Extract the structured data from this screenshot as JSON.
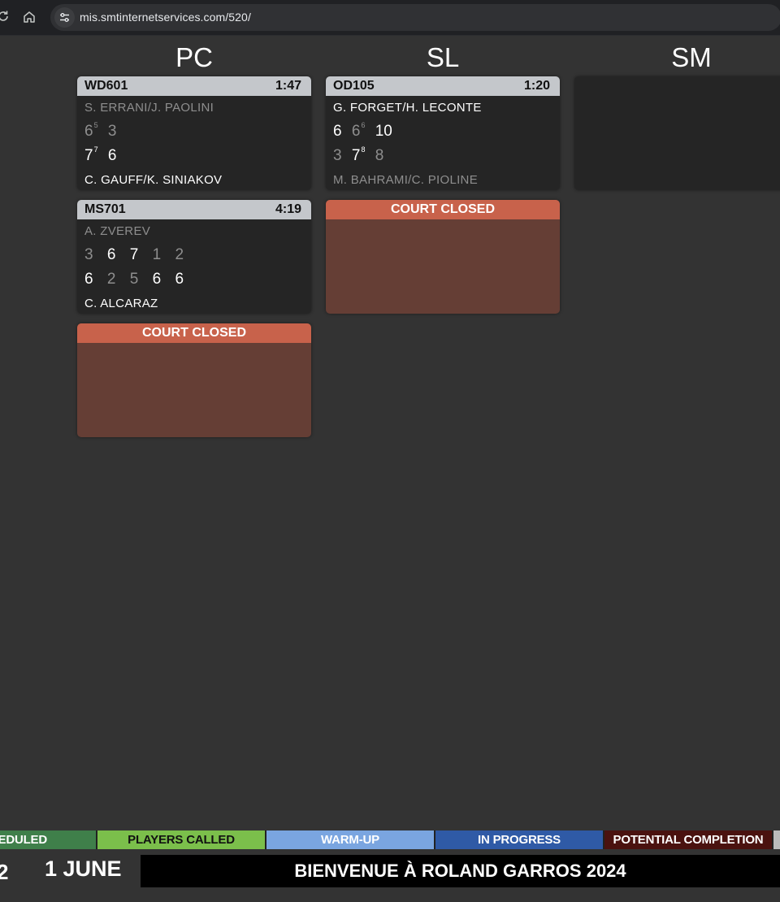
{
  "browser": {
    "url": "mis.smtinternetservices.com/520/"
  },
  "courts": [
    {
      "code": "PC"
    },
    {
      "code": "SL"
    },
    {
      "code": "SM"
    }
  ],
  "matches": [
    {
      "id": "WD601",
      "duration": "1:47",
      "team_top": "S. ERRANI/J. PAOLINI",
      "team_bottom": "C. GAUFF/K. SINIAKOV",
      "top_scores": [
        "6",
        "3"
      ],
      "top_tiebreaks": [
        "5",
        ""
      ],
      "bottom_scores": [
        "7",
        "6"
      ],
      "bottom_tiebreaks": [
        "7",
        ""
      ]
    },
    {
      "id": "OD105",
      "duration": "1:20",
      "team_top": "G. FORGET/H. LECONTE",
      "team_bottom": "M. BAHRAMI/C. PIOLINE",
      "top_scores": [
        "6",
        "6",
        "10"
      ],
      "top_tiebreaks": [
        "",
        "6",
        ""
      ],
      "bottom_scores": [
        "3",
        "7",
        "8"
      ],
      "bottom_tiebreaks": [
        "",
        "8",
        ""
      ]
    },
    {
      "id": "MS701",
      "duration": "4:19",
      "team_top": "A. ZVEREV",
      "team_bottom": "C. ALCARAZ",
      "top_scores": [
        "3",
        "6",
        "7",
        "1",
        "2"
      ],
      "bottom_scores": [
        "6",
        "2",
        "5",
        "6",
        "6"
      ]
    }
  ],
  "closed_label": "COURT CLOSED",
  "legend": {
    "scheduled": "HEDULED",
    "players_called": "PLAYERS CALLED",
    "warm_up": "WARM-UP",
    "in_progress": "IN PROGRESS",
    "potential_completion": "POTENTIAL COMPLETION"
  },
  "footer": {
    "edge_text": "2",
    "date": "1 JUNE",
    "ticker": "BIENVENUE À ROLAND GARROS 2024"
  },
  "colors": {
    "background": "#333333",
    "card": "#252525",
    "card_header": "#c4c7cb",
    "closed_header": "#c8624b",
    "closed_body": "#653e35",
    "winner_text": "#ffffff",
    "loser_text": "#8e8e8e",
    "scheduled": "#3f7f4a",
    "players_called": "#7bbf4b",
    "warm_up": "#7aa5e0",
    "in_progress": "#2f5aa6",
    "potential_completion": "#4a120f"
  },
  "icons": [
    "reload-icon",
    "home-icon",
    "site-settings-icon"
  ]
}
